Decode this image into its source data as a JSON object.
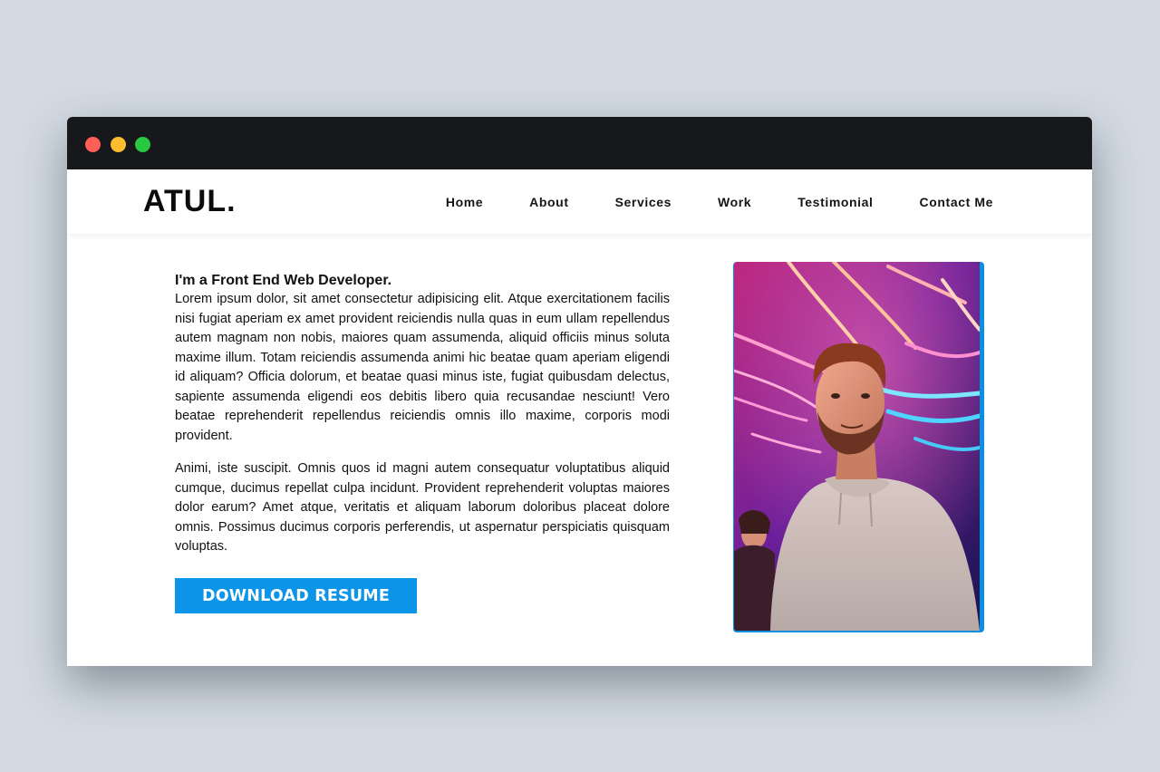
{
  "brand": {
    "logo": "ATUL."
  },
  "nav": {
    "items": [
      "Home",
      "About",
      "Services",
      "Work",
      "Testimonial",
      "Contact Me"
    ]
  },
  "about": {
    "heading": "I'm a Front End Web Developer.",
    "paragraph1": "Lorem ipsum dolor, sit amet consectetur adipisicing elit. Atque exercitationem facilis nisi fugiat aperiam ex amet provident reiciendis nulla quas in eum ullam repellendus autem magnam non nobis, maiores quam assumenda, aliquid officiis minus soluta maxime illum. Totam reiciendis assumenda animi hic beatae quam aperiam eligendi id aliquam? Officia dolorum, et beatae quasi minus iste, fugiat quibusdam delectus, sapiente assumenda eligendi eos debitis libero quia recusandae nesciunt! Vero beatae reprehenderit repellendus reiciendis omnis illo maxime, corporis modi provident.",
    "paragraph2": "Animi, iste suscipit. Omnis quos id magni autem consequatur voluptatibus aliquid cumque, ducimus repellat culpa incidunt. Provident reprehenderit voluptas maiores dolor earum? Amet atque, veritatis et aliquam laborum doloribus placeat dolore omnis. Possimus ducimus corporis perferendis, ut aspernatur perspiciatis quisquam voluptas.",
    "button_label": "DOWNLOAD RESUME"
  },
  "colors": {
    "accent": "#0c95e8",
    "titlebar": "#17181b",
    "background": "#d3dae2"
  },
  "icons": {
    "window_controls": [
      "close-dot",
      "minimize-dot",
      "maximize-dot"
    ]
  }
}
